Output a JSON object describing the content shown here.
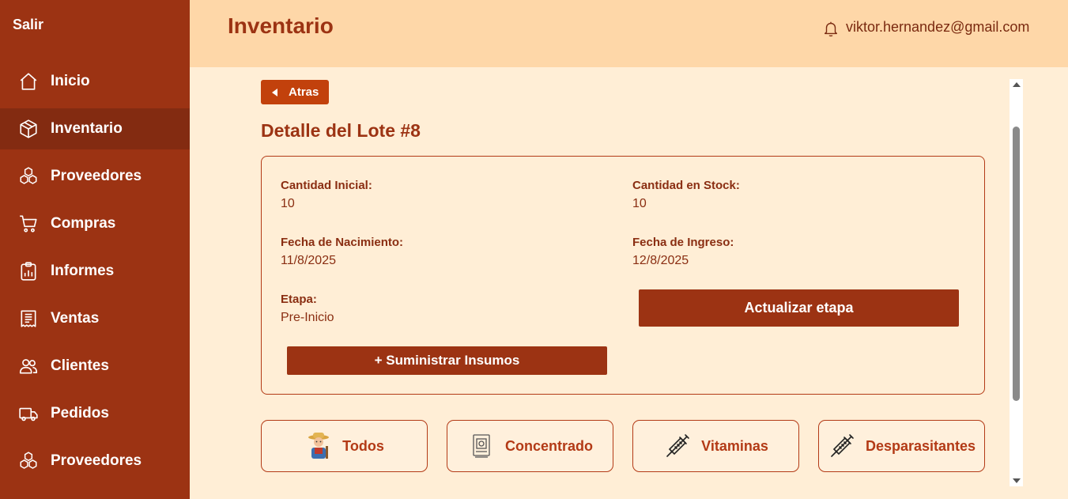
{
  "sidebar": {
    "logout_label": "Salir",
    "items": [
      {
        "label": "Inicio",
        "icon": "home-icon"
      },
      {
        "label": "Inventario",
        "icon": "box-icon",
        "active": true
      },
      {
        "label": "Proveedores",
        "icon": "boxes-icon"
      },
      {
        "label": "Compras",
        "icon": "cart-icon"
      },
      {
        "label": "Informes",
        "icon": "report-icon"
      },
      {
        "label": "Ventas",
        "icon": "receipt-icon"
      },
      {
        "label": "Clientes",
        "icon": "users-icon"
      },
      {
        "label": "Pedidos",
        "icon": "truck-icon"
      },
      {
        "label": "Proveedores",
        "icon": "boxes-icon"
      }
    ]
  },
  "header": {
    "title": "Inventario",
    "user_email": "viktor.hernandez@gmail.com"
  },
  "main": {
    "back_label": "Atras",
    "lote_title": "Detalle del Lote #8",
    "fields": {
      "cantidad_inicial_label": "Cantidad Inicial:",
      "cantidad_inicial_value": "10",
      "cantidad_stock_label": "Cantidad en Stock:",
      "cantidad_stock_value": "10",
      "fecha_nacimiento_label": "Fecha de Nacimiento:",
      "fecha_nacimiento_value": "11/8/2025",
      "fecha_ingreso_label": "Fecha de Ingreso:",
      "fecha_ingreso_value": "12/8/2025",
      "etapa_label": "Etapa:",
      "etapa_value": "Pre-Inicio"
    },
    "update_stage_label": "Actualizar etapa",
    "supply_label": "+ Suministrar Insumos",
    "filters": [
      {
        "label": "Todos",
        "icon": "farmer-icon"
      },
      {
        "label": "Concentrado",
        "icon": "feed-bag-icon"
      },
      {
        "label": "Vitaminas",
        "icon": "syringe-icon"
      },
      {
        "label": "Desparasitantes",
        "icon": "syringe-icon"
      }
    ]
  },
  "colors": {
    "sidebar_bg": "#9c3313",
    "sidebar_active": "#832b11",
    "header_bg": "#fed7a8",
    "content_bg": "#ffeed6",
    "accent": "#c2410c",
    "primary_button": "#9c3313"
  }
}
